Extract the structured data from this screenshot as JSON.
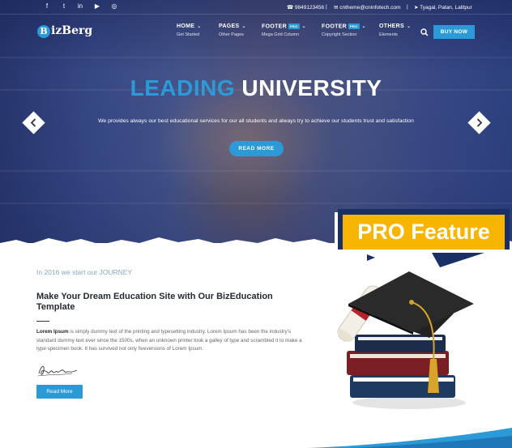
{
  "topbar": {
    "social_icons": [
      "facebook-icon",
      "twitter-icon",
      "linkedin-icon",
      "youtube-icon",
      "dribbble-icon"
    ],
    "social_glyphs": [
      "f",
      "t",
      "in",
      "▶",
      "◎"
    ],
    "phone": "9849123456",
    "email": "cntheme@cninfotech.com",
    "location": "Tyagal, Patan, Lalitpur"
  },
  "nav": {
    "logo_letter": "B",
    "logo_text": "izBerg",
    "items": [
      {
        "label": "HOME",
        "sub": "Get Started"
      },
      {
        "label": "PAGES",
        "sub": "Other Pages"
      },
      {
        "label": "FOOTER",
        "badge": "PRO",
        "sub": "Mega Grid Column"
      },
      {
        "label": "FOOTER",
        "badge": "PRO",
        "sub": "Copyright Section"
      },
      {
        "label": "OTHERS",
        "sub": "Elements"
      }
    ],
    "buy_label": "BUY NOW"
  },
  "hero": {
    "title_part1": "LEADING",
    "title_part2": "UNIVERSITY",
    "description": "We provides always our best educational services for our all students and always try to achieve our students trust and satisfaction",
    "button_label": "READ MORE"
  },
  "pro_feature": {
    "label": "PRO Feature"
  },
  "about": {
    "kicker": "In 2016 we start our JOURNEY",
    "title": "Make Your Dream Education Site with Our BizEducation Template",
    "body_bold": "Lorem Ipsum",
    "body_rest": " is simply dummy text of the printing and typesetting industry. Lorem Ipsum has been the industry's standard dummy text ever since the 1500s, when an unknown printer took a galley of type and scrambled it to make a type specimen book. It has survived not only fiveversions of Lorem Ipsum.",
    "button_label": "Read More"
  },
  "colors": {
    "accent": "#2d9ad8",
    "pro_yellow": "#f7b500",
    "hero_navy": "#3c4f8d",
    "heading": "#252a33"
  }
}
